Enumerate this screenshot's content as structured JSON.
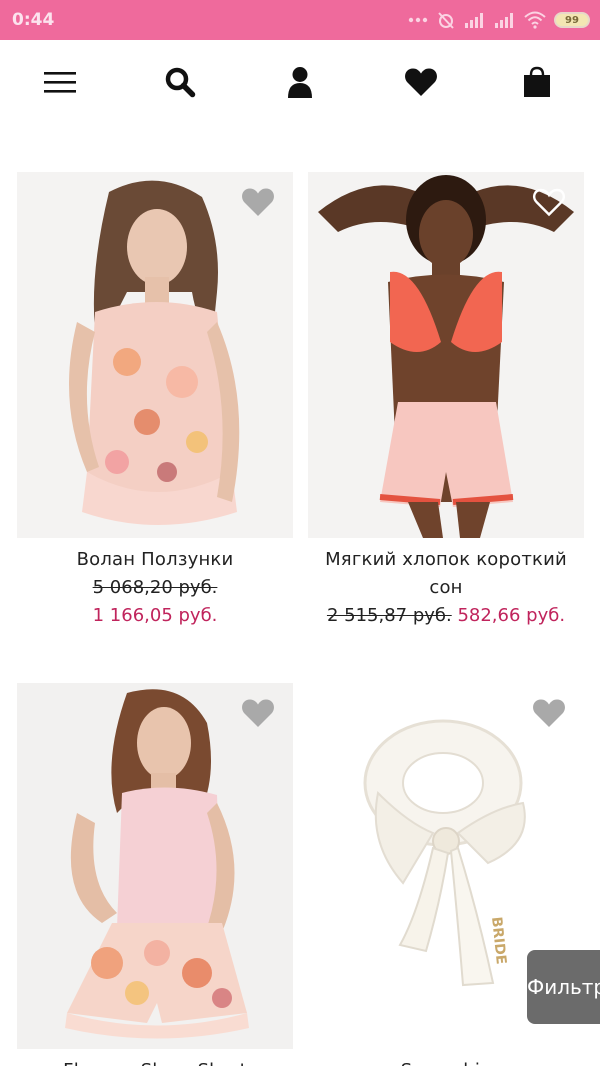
{
  "status_bar": {
    "time": "0:44",
    "battery": "99"
  },
  "nav": {
    "menu_icon": "menu-icon",
    "search_icon": "search-icon",
    "account_icon": "account-icon",
    "wishlist_icon": "heart-icon",
    "cart_icon": "shopping-bag-icon"
  },
  "products": [
    {
      "title": "Волан Ползунки",
      "old_price": "5 068,20 руб.",
      "new_price": "1 166,05 руб."
    },
    {
      "title_line1": "Мягкий хлопок короткий",
      "title_line2": "сон",
      "old_price": "2 515,87 руб.",
      "new_price": "582,66 руб."
    },
    {
      "title": "Flounce Sleep Short"
    },
    {
      "title": "Scrunchie"
    }
  ],
  "filter": {
    "label": "Фильтр"
  }
}
